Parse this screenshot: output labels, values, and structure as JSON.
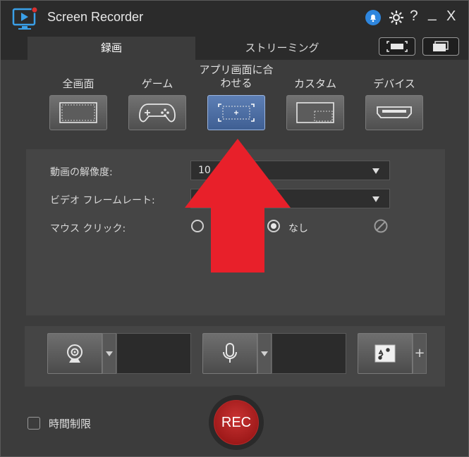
{
  "app": {
    "title": "Screen Recorder",
    "accent": "#3f5f93",
    "rec_color": "#b01a1a"
  },
  "window_icons": [
    "notification-bell-icon",
    "gear-icon",
    "help-icon",
    "minimize-icon",
    "close-icon"
  ],
  "window_icon_glyphs": {
    "help": "?",
    "minimize": "_",
    "close": "X"
  },
  "tabs": [
    {
      "label": "録画",
      "active": true
    },
    {
      "label": "ストリーミング",
      "active": false
    }
  ],
  "modes": [
    {
      "label": "全画面",
      "icon": "fullscreen-icon"
    },
    {
      "label": "ゲーム",
      "icon": "gamepad-icon"
    },
    {
      "label": "アプリ画面に合わせる",
      "line1": "アプリ画面に合",
      "line2": "わせる",
      "icon": "app-window-icon",
      "active": true
    },
    {
      "label": "カスタム",
      "icon": "custom-area-icon"
    },
    {
      "label": "デバイス",
      "icon": "hdmi-device-icon"
    }
  ],
  "settings": {
    "resolution_label": "動画の解像度:",
    "resolution_value": "10",
    "framerate_label": "ビデオ フレームレート:",
    "framerate_value": "",
    "mouse_click_label": "マウス クリック:",
    "mouse_none_label": "なし"
  },
  "bottom": {
    "time_limit_label": "時間制限",
    "rec_label": "REC",
    "effects_plus": "+"
  }
}
